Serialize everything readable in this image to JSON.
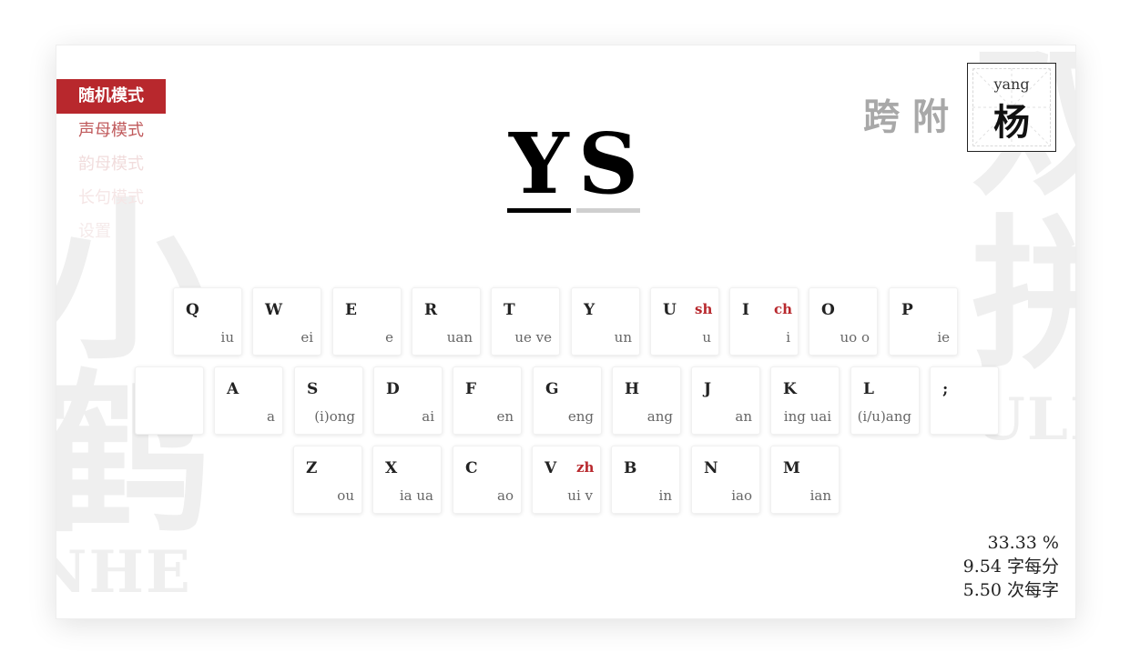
{
  "background": {
    "left_chars": [
      "小",
      "鹤"
    ],
    "left_word": "NHE",
    "right_chars": [
      "双",
      "拼"
    ],
    "right_word": "ULI"
  },
  "menu": {
    "items": [
      {
        "label": "随机模式",
        "active": true
      },
      {
        "label": "声母模式"
      },
      {
        "label": "韵母模式"
      },
      {
        "label": "长句模式"
      },
      {
        "label": "设置"
      }
    ]
  },
  "code": {
    "letters": [
      "Y",
      "S"
    ]
  },
  "prev_chars": "跨附",
  "current": {
    "pinyin": "yang",
    "hanzi": "杨"
  },
  "keyboard": {
    "row1": [
      {
        "letter": "Q",
        "shen": "",
        "yun": "iu"
      },
      {
        "letter": "W",
        "shen": "",
        "yun": "ei"
      },
      {
        "letter": "E",
        "shen": "",
        "yun": "e"
      },
      {
        "letter": "R",
        "shen": "",
        "yun": "uan"
      },
      {
        "letter": "T",
        "shen": "",
        "yun": "ue ve"
      },
      {
        "letter": "Y",
        "shen": "",
        "yun": "un"
      },
      {
        "letter": "U",
        "shen": "sh",
        "yun": "u"
      },
      {
        "letter": "I",
        "shen": "ch",
        "yun": "i"
      },
      {
        "letter": "O",
        "shen": "",
        "yun": "uo o"
      },
      {
        "letter": "P",
        "shen": "",
        "yun": "ie"
      }
    ],
    "row2": [
      {
        "letter": "",
        "shen": "",
        "yun": ""
      },
      {
        "letter": "A",
        "shen": "",
        "yun": "a"
      },
      {
        "letter": "S",
        "shen": "",
        "yun": "(i)ong"
      },
      {
        "letter": "D",
        "shen": "",
        "yun": "ai"
      },
      {
        "letter": "F",
        "shen": "",
        "yun": "en"
      },
      {
        "letter": "G",
        "shen": "",
        "yun": "eng"
      },
      {
        "letter": "H",
        "shen": "",
        "yun": "ang"
      },
      {
        "letter": "J",
        "shen": "",
        "yun": "an"
      },
      {
        "letter": "K",
        "shen": "",
        "yun": "ing uai"
      },
      {
        "letter": "L",
        "shen": "",
        "yun": "(i/u)ang"
      },
      {
        "letter": ";",
        "shen": "",
        "yun": ""
      }
    ],
    "row3": [
      {
        "letter": "Z",
        "shen": "",
        "yun": "ou"
      },
      {
        "letter": "X",
        "shen": "",
        "yun": "ia ua"
      },
      {
        "letter": "C",
        "shen": "",
        "yun": "ao"
      },
      {
        "letter": "V",
        "shen": "zh",
        "yun": "ui v"
      },
      {
        "letter": "B",
        "shen": "",
        "yun": "in"
      },
      {
        "letter": "N",
        "shen": "",
        "yun": "iao"
      },
      {
        "letter": "M",
        "shen": "",
        "yun": "ian"
      }
    ]
  },
  "stats": {
    "accuracy": "33.33 %",
    "speed": "9.54 字每分",
    "strokes": "5.50 次每字"
  },
  "colors": {
    "accent": "#b8282d"
  }
}
